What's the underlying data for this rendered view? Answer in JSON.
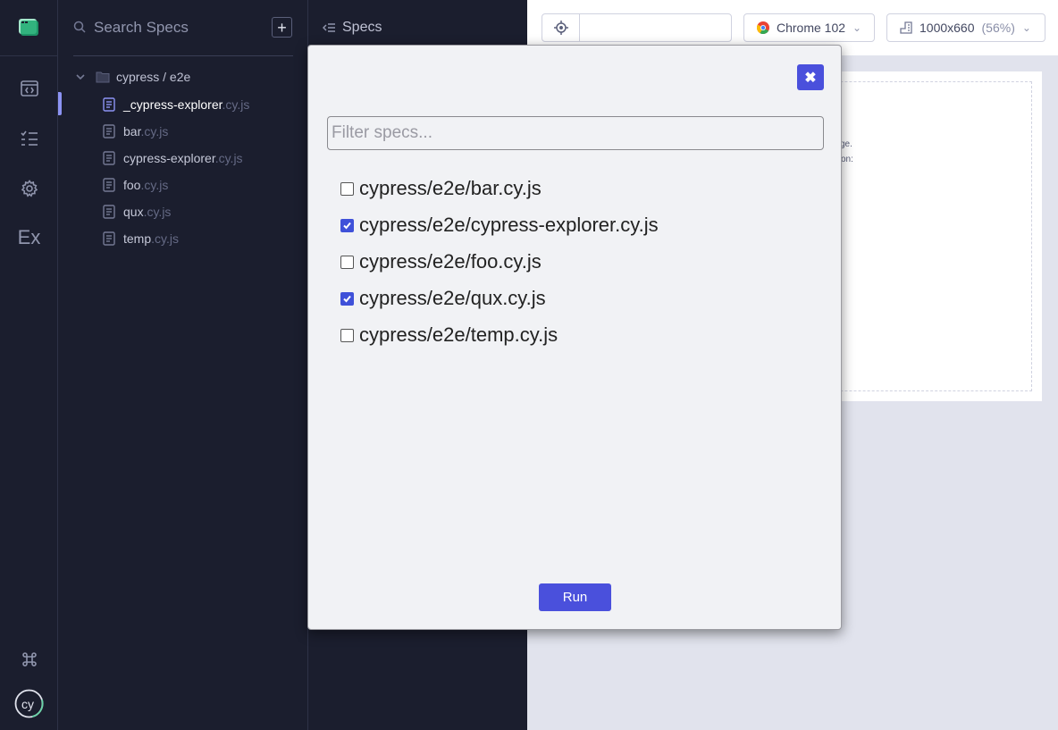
{
  "sidebar": {
    "nav_items": [
      {
        "name": "runs",
        "icon": "code-window-icon"
      },
      {
        "name": "specs",
        "icon": "checklist-icon"
      },
      {
        "name": "settings",
        "icon": "gear-icon"
      }
    ],
    "ex_label": "Ex",
    "bottom": {
      "shortcut_icon": "command-icon",
      "logo_text": "cy"
    }
  },
  "specs_panel": {
    "search_placeholder": "Search Specs",
    "add_label": "+",
    "folder": "cypress / e2e",
    "items": [
      {
        "name": "_cypress-explorer",
        "ext": ".cy.js",
        "active": true
      },
      {
        "name": "bar",
        "ext": ".cy.js",
        "active": false
      },
      {
        "name": "cypress-explorer",
        "ext": ".cy.js",
        "active": false
      },
      {
        "name": "foo",
        "ext": ".cy.js",
        "active": false
      },
      {
        "name": "qux",
        "ext": ".cy.js",
        "active": false
      },
      {
        "name": "temp",
        "ext": ".cy.js",
        "active": false
      }
    ]
  },
  "runner": {
    "title": "Specs"
  },
  "aut": {
    "browser": "Chrome 102",
    "viewport": "1000x660",
    "zoom": "(56%)",
    "ghost_text": [
      "ge.",
      "on:"
    ]
  },
  "modal": {
    "close_label": "✖",
    "filter_placeholder": "Filter specs...",
    "options": [
      {
        "label": "cypress/e2e/bar.cy.js",
        "checked": false
      },
      {
        "label": "cypress/e2e/cypress-explorer.cy.js",
        "checked": true
      },
      {
        "label": "cypress/e2e/foo.cy.js",
        "checked": false
      },
      {
        "label": "cypress/e2e/qux.cy.js",
        "checked": true
      },
      {
        "label": "cypress/e2e/temp.cy.js",
        "checked": false
      }
    ],
    "run_label": "Run"
  },
  "colors": {
    "accent": "#4a50dc",
    "sidebar_bg": "#1b1e2e",
    "active_indicator": "#8c93f3"
  }
}
